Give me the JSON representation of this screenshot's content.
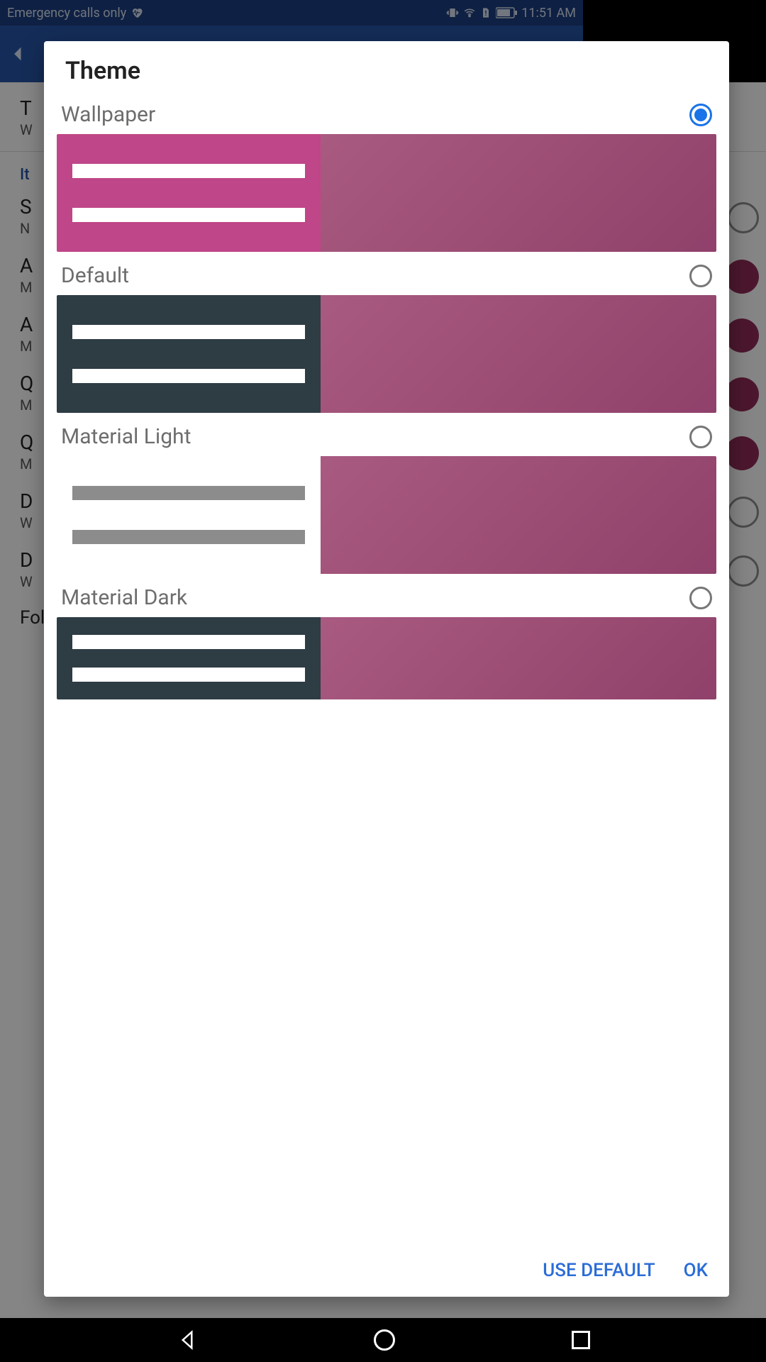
{
  "statusbar": {
    "network_text": "Emergency calls only",
    "time": "11:51 AM"
  },
  "background": {
    "theme_title": "T",
    "theme_sub": "W",
    "section_header": "It",
    "rows": [
      {
        "title": "S",
        "sub": "N"
      },
      {
        "title": "A",
        "sub": "M"
      },
      {
        "title": "A",
        "sub": "M"
      },
      {
        "title": "Q",
        "sub": "M"
      },
      {
        "title": "Q",
        "sub": "M"
      },
      {
        "title": "D",
        "sub": "W"
      },
      {
        "title": "D",
        "sub": "W"
      }
    ],
    "folder_row": "Folder icon background"
  },
  "dialog": {
    "title": "Theme",
    "options": [
      {
        "label": "Wallpaper",
        "selected": true
      },
      {
        "label": "Default",
        "selected": false
      },
      {
        "label": "Material Light",
        "selected": false
      },
      {
        "label": "Material Dark",
        "selected": false
      }
    ],
    "use_default": "USE DEFAULT",
    "ok": "OK"
  },
  "colors": {
    "accent_blue": "#1a73e8",
    "wallpaper_pink": "#bf4688",
    "slate": "#2e3c44",
    "preview_gradient_start": "#a95a80",
    "preview_gradient_end": "#8f416b"
  }
}
